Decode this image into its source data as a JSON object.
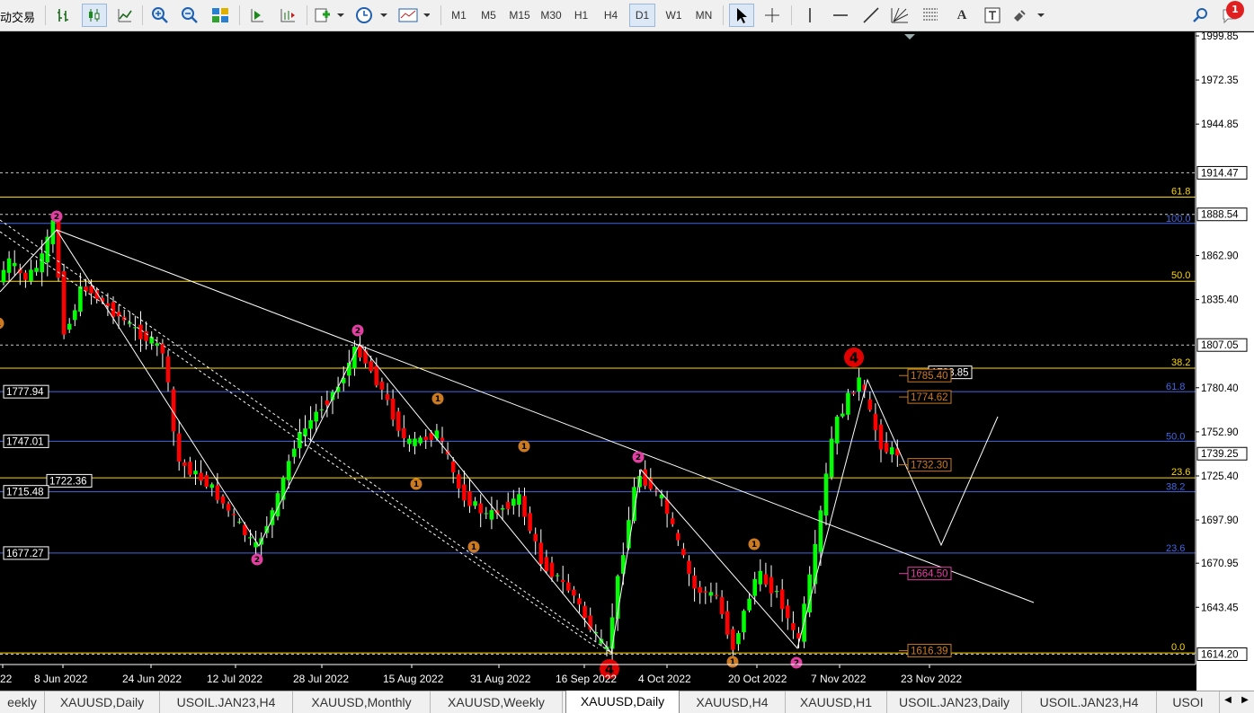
{
  "toolbar": {
    "auto_trading_label": "动交易",
    "timeframes": [
      "M1",
      "M5",
      "M15",
      "M30",
      "H1",
      "H4",
      "D1",
      "W1",
      "MN"
    ],
    "active_timeframe": "D1",
    "text_tool_label": "A",
    "notification_count": "1",
    "icons": [
      "bar-chart-icon",
      "candle-chart-icon",
      "line-chart-icon",
      "zoom-in-icon",
      "zoom-out-icon",
      "tile-windows-icon",
      "autoscroll-icon",
      "chart-shift-icon",
      "new-order-icon",
      "clock-icon",
      "template-icon",
      "cursor-icon",
      "crosshair-icon",
      "vertical-line-icon",
      "horizontal-line-icon",
      "trendline-icon",
      "gann-fan-icon",
      "fibonacci-icon",
      "text-icon",
      "text-label-icon",
      "shapes-icon",
      "search-icon",
      "chat-icon"
    ]
  },
  "chart": {
    "symbol": "XAUUSD",
    "period": "Daily",
    "colors": {
      "background": "#000000",
      "bull": "#00ff00",
      "bear": "#ff0000",
      "grid_text": "#ffffff",
      "fib_yellow": "#ffd700",
      "fib_blue": "#4169e1",
      "wave_magenta": "#e040a0",
      "wave_orange": "#cc7a22"
    },
    "y_axis_labels": [
      "1999.85",
      "1972.35",
      "1944.85",
      "1862.90",
      "1835.40",
      "1780.40",
      "1752.90",
      "1725.40",
      "1697.90",
      "1670.95",
      "1643.45"
    ],
    "price_tags": [
      {
        "value": "1914.47",
        "price": 1914.47
      },
      {
        "value": "1888.54",
        "price": 1888.54
      },
      {
        "value": "1807.05",
        "price": 1807.05
      },
      {
        "value": "1739.25",
        "price": 1739.25
      },
      {
        "value": "1614.20",
        "price": 1614.2
      }
    ],
    "x_axis_labels": [
      "22",
      "8 Jun 2022",
      "24 Jun 2022",
      "12 Jul 2022",
      "28 Jul 2022",
      "15 Aug 2022",
      "31 Aug 2022",
      "16 Sep 2022",
      "4 Oct 2022",
      "20 Oct 2022",
      "7 Nov 2022",
      "23 Nov 2022"
    ],
    "fib_levels_left": [
      {
        "label": "61.8",
        "price": 1899.3,
        "color": "#ffd700"
      },
      {
        "label": "50.0",
        "price": 1846.8,
        "color": "#ffd700"
      },
      {
        "label": "38.2",
        "price": 1792.6,
        "color": "#ffd700"
      },
      {
        "label": "23.6",
        "price": 1724.2,
        "color": "#ffd700"
      },
      {
        "label": "0.0",
        "price": 1615.0,
        "color": "#ffd700"
      }
    ],
    "fib_levels_right": [
      {
        "label": "100.0",
        "price": 1882.9,
        "color": "#4169e1"
      },
      {
        "label": "61.8",
        "price": 1777.94,
        "color": "#4169e1"
      },
      {
        "label": "50.0",
        "price": 1747.01,
        "color": "#4169e1"
      },
      {
        "label": "38.2",
        "price": 1715.48,
        "color": "#4169e1"
      },
      {
        "label": "23.6",
        "price": 1677.27,
        "color": "#4169e1"
      }
    ],
    "left_boxes": [
      {
        "value": "1777.94",
        "price": 1777.94
      },
      {
        "value": "1747.01",
        "price": 1747.01
      },
      {
        "value": "1722.36",
        "price": 1722.36
      },
      {
        "value": "1715.48",
        "price": 1715.48
      },
      {
        "value": "1677.27",
        "price": 1677.27
      }
    ],
    "right_boxes": [
      {
        "value": "1783.85",
        "price": 1790.0,
        "color": "#ffffff"
      },
      {
        "value": "1785.40",
        "price": 1788.0,
        "color": "#cc7a22"
      },
      {
        "value": "1774.62",
        "price": 1774.62,
        "color": "#cc7a22"
      },
      {
        "value": "1732.30",
        "price": 1732.3,
        "color": "#cc7a22"
      },
      {
        "value": "1664.50",
        "price": 1664.5,
        "color": "#e040a0"
      },
      {
        "value": "1616.39",
        "price": 1616.39,
        "color": "#cc7a22"
      }
    ],
    "wave_labels": [
      {
        "text": "2",
        "kind": "magenta"
      },
      {
        "text": "2",
        "kind": "magenta"
      },
      {
        "text": "2",
        "kind": "magenta"
      },
      {
        "text": "2",
        "kind": "magenta"
      },
      {
        "text": "2",
        "kind": "magenta"
      },
      {
        "text": "1",
        "kind": "orange"
      },
      {
        "text": "1",
        "kind": "orange"
      },
      {
        "text": "1",
        "kind": "orange"
      },
      {
        "text": "1",
        "kind": "orange"
      },
      {
        "text": "1",
        "kind": "orange"
      },
      {
        "text": "1",
        "kind": "orange"
      },
      {
        "text": "1",
        "kind": "orange"
      },
      {
        "text": "4",
        "kind": "red"
      },
      {
        "text": "4",
        "kind": "red"
      }
    ]
  },
  "tabs": {
    "items": [
      "eekly",
      "XAUUSD,Daily",
      "USOIL.JAN23,H4",
      "XAUUSD,Monthly",
      "XAUUSD,Weekly",
      "XAUUSD,Daily",
      "XAUUSD,H4",
      "XAUUSD,H1",
      "USOIL.JAN23,Daily",
      "USOIL.JAN23,H4",
      "USOI"
    ],
    "active_index": 5
  }
}
